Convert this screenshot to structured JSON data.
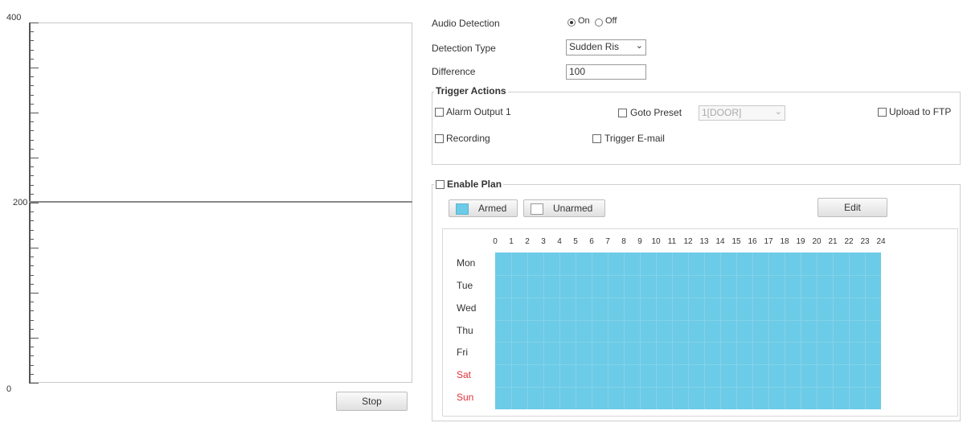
{
  "graph": {
    "y_top": "400",
    "y_mid": "200",
    "y_bottom": "0",
    "stop_label": "Stop"
  },
  "form": {
    "audio_detection_label": "Audio Detection",
    "on_label": "On",
    "off_label": "Off",
    "audio_detection_value": "On",
    "detection_type_label": "Detection Type",
    "detection_type_value": "Sudden Ris",
    "difference_label": "Difference",
    "difference_value": "100"
  },
  "trigger_actions": {
    "title": "Trigger Actions",
    "alarm_output": "Alarm Output 1",
    "goto_preset": "Goto Preset",
    "preset_value": "1[DOOR]",
    "upload_ftp": "Upload to FTP",
    "recording": "Recording",
    "trigger_email": "Trigger E-mail"
  },
  "plan": {
    "enable_label": "Enable Plan",
    "armed_label": "Armed",
    "unarmed_label": "Unarmed",
    "edit_label": "Edit",
    "armed_color": "#6ccbe6",
    "hours": [
      "0",
      "1",
      "2",
      "3",
      "4",
      "5",
      "6",
      "7",
      "8",
      "9",
      "10",
      "11",
      "12",
      "13",
      "14",
      "15",
      "16",
      "17",
      "18",
      "19",
      "20",
      "21",
      "22",
      "23",
      "24"
    ],
    "days": [
      "Mon",
      "Tue",
      "Wed",
      "Thu",
      "Fri",
      "Sat",
      "Sun"
    ]
  }
}
